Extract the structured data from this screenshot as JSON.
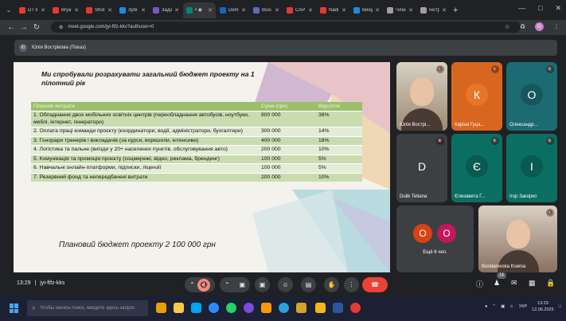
{
  "browser": {
    "tabs": [
      {
        "title": "DT li",
        "color": "#e53935"
      },
      {
        "title": "Brya",
        "color": "#e53935"
      },
      {
        "title": "Shut",
        "color": "#e53935"
      },
      {
        "title": "Зубі",
        "color": "#1e88e5"
      },
      {
        "title": "Зада",
        "color": "#7e57c2"
      },
      {
        "title": "• ◉",
        "color": "#00897b",
        "active": true
      },
      {
        "title": "Dem",
        "color": "#1565c0"
      },
      {
        "title": "Busi",
        "color": "#5c6bc0"
      },
      {
        "title": "CAP",
        "color": "#e53935"
      },
      {
        "title": "Nadi",
        "color": "#e53935"
      },
      {
        "title": "Вихід",
        "color": "#1e88e5"
      },
      {
        "title": "Член",
        "color": "#9e9e9e"
      },
      {
        "title": "Інстр",
        "color": "#9e9e9e"
      }
    ],
    "url": "meet.google.com/jyi-ftfz-kks?authuser=0",
    "profile_initial": "G"
  },
  "meet": {
    "presenter_label": "Юлія Вострікова (Показ)",
    "presenter_initial": "Ю",
    "slide": {
      "title": "Ми спробували розрахувати загальний бюджет проекту на 1 пілотний рік",
      "headers": [
        "Планові витрати",
        "Сума (грн)",
        "Відсоток"
      ],
      "rows": [
        [
          "1. Обладнання двох мобільних освітніх центрів (переобладнання автобусів, ноутбуки, меблі, інтернет, генератори)",
          "800 000",
          "38%"
        ],
        [
          "2. Оплата праці команди проєкту (координатори, водії, адміністратори, бухгалтери)",
          "300 000",
          "14%"
        ],
        [
          "3. Гонорари тренерів і викладачів (за курси, воркшопи, інтенсиви)",
          "400 000",
          "18%"
        ],
        [
          "4. Логістика та пальне (виїзди у 20+ населених пунктів, обслуговування авто)",
          "200 000",
          "10%"
        ],
        [
          "5. Комунікація та промоція проєкту (соцмережі, відео, реклама, брендинг)",
          "100 000",
          "5%"
        ],
        [
          "6. Навчальні онлайн-платформи, підписки, ліцензії",
          "100 000",
          "5%"
        ],
        [
          "7. Резервний фонд та непередбачені витрати",
          "200 000",
          "10%"
        ]
      ],
      "budget_text": "Плановий бюджет проекту 2 100 000 грн"
    },
    "participants": [
      {
        "name": "Юлія Вострі...",
        "initial": "",
        "color": "#9c8a70",
        "video": true
      },
      {
        "name": "Каріна Гуца...",
        "initial": "К",
        "color": "#d9661e"
      },
      {
        "name": "Олександр...",
        "initial": "О",
        "color": "#1c6b73"
      },
      {
        "name": "Dulik Tetiana",
        "initial": "D",
        "color": "#3c4043"
      },
      {
        "name": "Єлизавета Г...",
        "initial": "Є",
        "color": "#0b6e63"
      },
      {
        "name": "Ігор Закорко",
        "initial": "І",
        "color": "#0b6e63"
      },
      {
        "name": "Bondarevska Ksenia",
        "initial": "",
        "color": "#8a7060",
        "video": true
      }
    ],
    "more_label": "Ещё 6 чел.",
    "more_initials": [
      "O",
      "O"
    ],
    "time": "13:29",
    "meeting_code": "jyi-ftfz-kks",
    "participant_count": "14"
  },
  "taskbar": {
    "search_placeholder": "Чтобы начать поиск, введите здесь запрос",
    "lang": "УКР",
    "time": "13:29",
    "date": "12.06.2025"
  }
}
